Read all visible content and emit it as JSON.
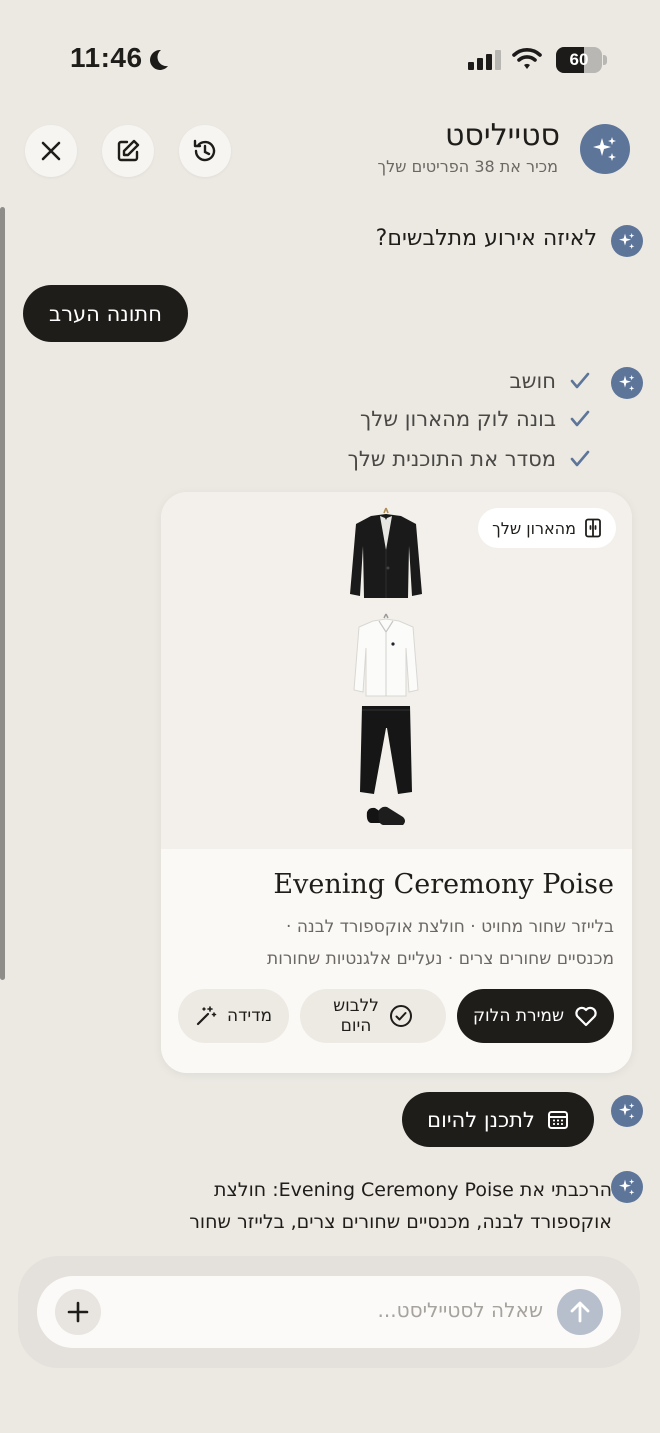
{
  "status_bar": {
    "time": "11:46",
    "battery": "60",
    "battery_level": 0.6
  },
  "header": {
    "title": "סטייליסט",
    "subtitle": "מכיר את 38 הפריטים שלך"
  },
  "chat": {
    "question": "לאיזה אירוע מתלבשים?",
    "user_answer": "חתונה הערב",
    "steps": [
      "חושב",
      "בונה לוק מהארון שלך",
      "מסדר את התוכנית שלך"
    ],
    "plan_button": "לתכנן להיום",
    "final_text_line1": "הרכבתי את Evening Ceremony Poise: חולצת",
    "final_text_line2": "אוקספורד לבנה, מכנסיים שחורים צרים, בלייזר שחור"
  },
  "look_card": {
    "badge": "מהארון שלך",
    "title": "Evening Ceremony Poise",
    "description_line1": "בלייזר שחור מחויט · חולצת אוקספורד לבנה ·",
    "description_line2": "מכנסיים שחורים צרים · נעליים אלגנטיות שחורות",
    "save_button": "שמירת הלוק",
    "wear_today_line1": "ללבוש",
    "wear_today_line2": "היום",
    "measure_button": "מדידה"
  },
  "composer": {
    "placeholder": "שאלה לסטייליסט..."
  },
  "colors": {
    "accent": "#5E759A",
    "dark": "#1F1D1A",
    "background": "#ECE9E3"
  }
}
